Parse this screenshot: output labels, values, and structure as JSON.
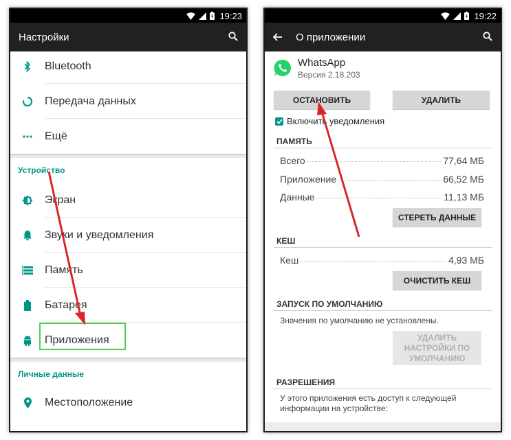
{
  "left": {
    "status_time": "19:23",
    "title": "Настройки",
    "items_top": [
      {
        "label": "Bluetooth",
        "icon": "bluetooth-icon"
      },
      {
        "label": "Передача данных",
        "icon": "data-usage-icon"
      },
      {
        "label": "Ещё",
        "icon": "more-dots-icon"
      }
    ],
    "section_device": "Устройство",
    "items_device": [
      {
        "label": "Экран",
        "icon": "brightness-icon"
      },
      {
        "label": "Звуки и уведомления",
        "icon": "bell-icon"
      },
      {
        "label": "Память",
        "icon": "storage-icon"
      },
      {
        "label": "Батарея",
        "icon": "battery-icon"
      },
      {
        "label": "Приложения",
        "icon": "android-icon"
      }
    ],
    "section_personal": "Личные данные",
    "items_personal": [
      {
        "label": "Местоположение",
        "icon": "location-icon"
      }
    ]
  },
  "right": {
    "status_time": "19:22",
    "title": "О приложении",
    "app_name": "WhatsApp",
    "app_version": "Версия 2.18.203",
    "btn_stop": "ОСТАНОВИТЬ",
    "btn_uninstall": "УДАЛИТЬ",
    "notifications_label": "Включить уведомления",
    "memory_title": "ПАМЯТЬ",
    "memory_rows": [
      {
        "label": "Всего",
        "value": "77,64 МБ"
      },
      {
        "label": "Приложение",
        "value": "66,52 МБ"
      },
      {
        "label": "Данные",
        "value": "11,13 МБ"
      }
    ],
    "btn_clear_data": "СТЕРЕТЬ ДАННЫЕ",
    "cache_title": "КЕШ",
    "cache_row": {
      "label": "Кеш",
      "value": "4,93 МБ"
    },
    "btn_clear_cache": "ОЧИСТИТЬ КЕШ",
    "default_title": "ЗАПУСК ПО УМОЛЧАНИЮ",
    "default_text": "Значения по умолчанию не установлены.",
    "btn_clear_defaults": "УДАЛИТЬ НАСТРОЙКИ ПО УМОЛЧАНИЮ",
    "permissions_title": "РАЗРЕШЕНИЯ",
    "permissions_text": "У этого приложения есть доступ к следующей информации на устройстве:"
  },
  "colors": {
    "accent": "#009688",
    "toolbar": "#212121",
    "arrow": "#d9262b",
    "highlight": "#4cd24a",
    "whatsapp": "#25d366"
  }
}
